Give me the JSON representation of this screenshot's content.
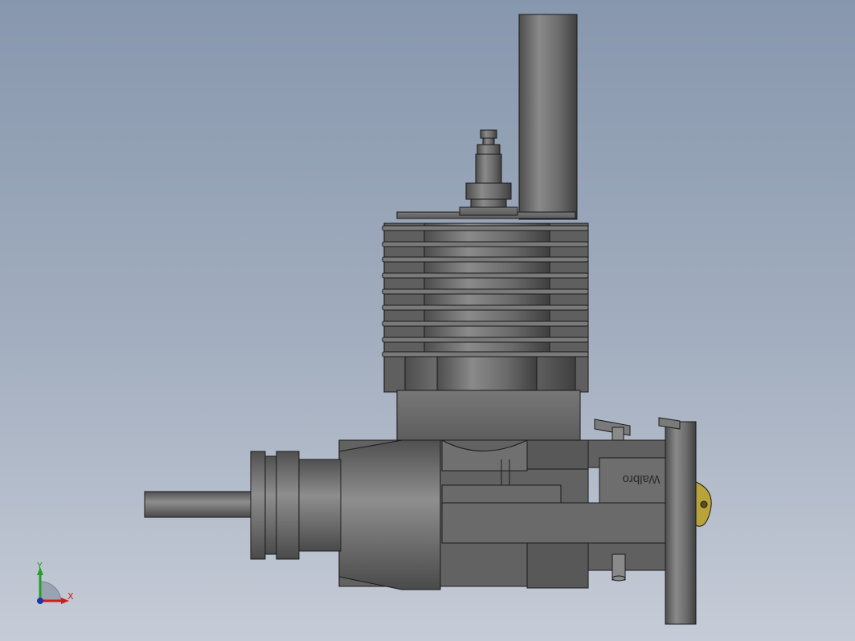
{
  "viewport": {
    "background_top": "#8797ad",
    "background_bottom": "#c6ccd7"
  },
  "model": {
    "body_color": "#6b6b6b",
    "edge_color": "#1a1a1a",
    "accent_color": "#b8a33a",
    "embossed_text": "Walbro"
  },
  "triad": {
    "x_label": "X",
    "y_label": "Y",
    "x_color": "#c8201e",
    "y_color": "#22a02a",
    "z_color": "#2230b0"
  }
}
